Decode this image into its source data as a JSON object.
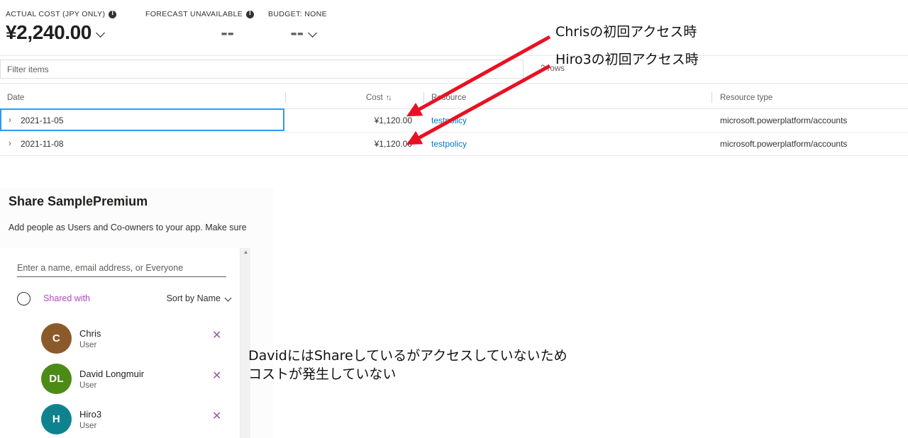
{
  "cost_summary": {
    "metrics": [
      {
        "label": "ACTUAL COST (JPY ONLY)",
        "value": "¥2,240.00",
        "has_info": true,
        "has_chevron": true
      },
      {
        "label": "FORECAST UNAVAILABLE",
        "value": "--",
        "has_info": true,
        "has_chevron": false
      },
      {
        "label": "BUDGET: NONE",
        "value": "--",
        "has_info": false,
        "has_chevron": true
      }
    ]
  },
  "filter_bar": {
    "placeholder": "Filter items",
    "value": "",
    "rows_count": "2 rows"
  },
  "cost_table": {
    "columns": [
      {
        "key": "date",
        "label": "Date"
      },
      {
        "key": "cost",
        "label": "Cost",
        "sort_icon": "↑↓"
      },
      {
        "key": "resource",
        "label": "Resource"
      },
      {
        "key": "resource_type",
        "label": "Resource type"
      }
    ],
    "rows": [
      {
        "expand": "›",
        "date": "2021-11-05",
        "cost": "¥1,120.00",
        "resource": "testpolicy",
        "resource_type": "microsoft.powerplatform/accounts",
        "selected": true
      },
      {
        "expand": "›",
        "date": "2021-11-08",
        "cost": "¥1,120.00",
        "resource": "testpolicy",
        "resource_type": "microsoft.powerplatform/accounts",
        "selected": false
      }
    ]
  },
  "share_panel": {
    "title": "Share SamplePremium",
    "subtitle": "Add people as Users and Co-owners to your app. Make sure",
    "name_input_placeholder": "Enter a name, email address, or Everyone",
    "name_input_value": "",
    "shared_with_label": "Shared with",
    "sort_by_label": "Sort by Name",
    "scroll_up_icon": "▲",
    "remove_icon": "✕",
    "users": [
      {
        "initials": "C",
        "name": "Chris",
        "role": "User",
        "color": "#8a5a2b"
      },
      {
        "initials": "DL",
        "name": "David Longmuir",
        "role": "User",
        "color": "#4b8b16"
      },
      {
        "initials": "H",
        "name": "Hiro3",
        "role": "User",
        "color": "#0f8290"
      }
    ]
  },
  "annotations": {
    "arrow_color": "#e81123",
    "chris_note": "Chrisの初回アクセス時",
    "hiro_note": "Hiro3の初回アクセス時",
    "david_note": "DavidにはShareしているがアクセスしていないため\nコストが発生していない"
  }
}
